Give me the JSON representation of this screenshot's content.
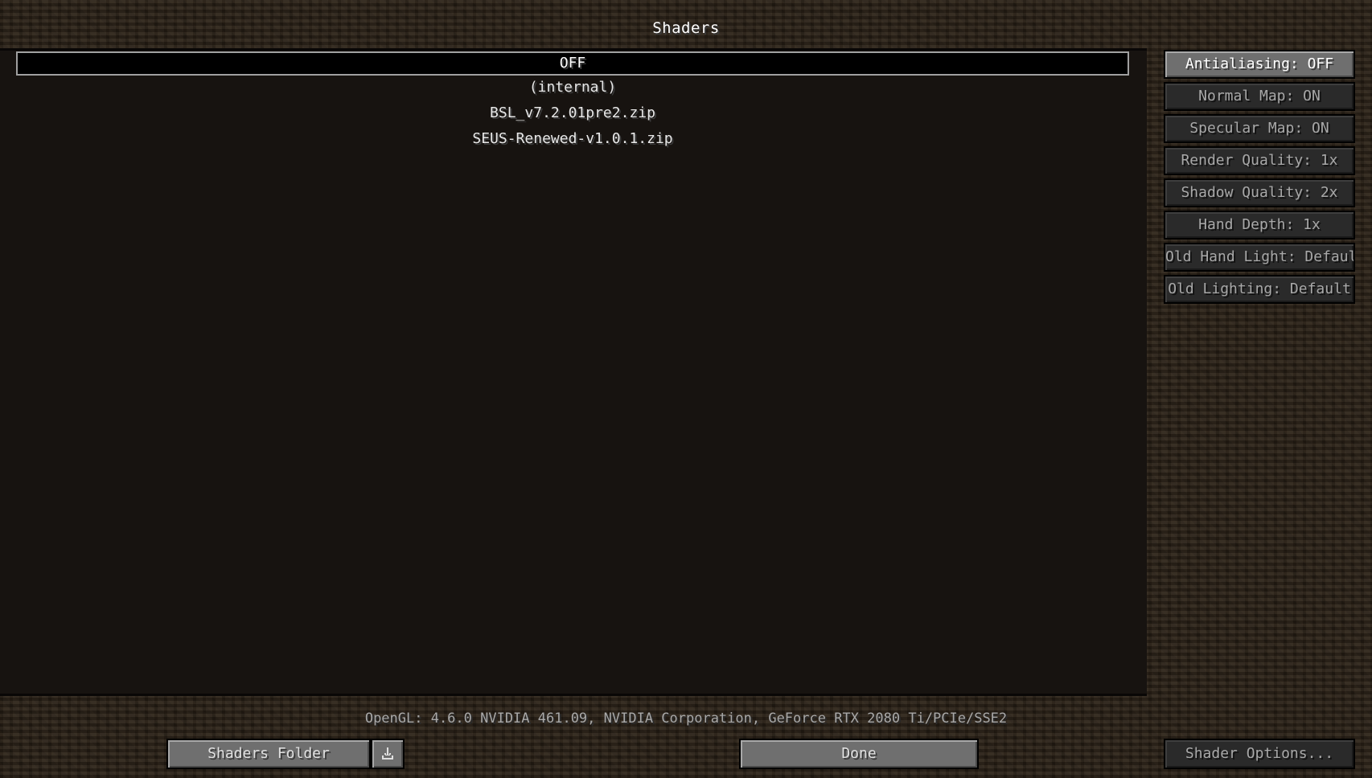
{
  "screen": {
    "title": "Shaders"
  },
  "shader_list": {
    "items": [
      {
        "label": "OFF",
        "selected": true
      },
      {
        "label": "(internal)",
        "selected": false
      },
      {
        "label": "BSL_v7.2.01pre2.zip",
        "selected": false
      },
      {
        "label": "SEUS-Renewed-v1.0.1.zip",
        "selected": false
      }
    ]
  },
  "settings": {
    "antialiasing": "Antialiasing: OFF",
    "normal_map": "Normal Map: ON",
    "specular_map": "Specular Map: ON",
    "render_quality": "Render Quality: 1x",
    "shadow_quality": "Shadow Quality: 2x",
    "hand_depth": "Hand Depth: 1x",
    "old_hand_light": "Old Hand Light: Default",
    "old_lighting": "Old Lighting: Default"
  },
  "footer": {
    "opengl_info": "OpenGL: 4.6.0 NVIDIA 461.09, NVIDIA Corporation, GeForce RTX 2080 Ti/PCIe/SSE2",
    "shaders_folder_label": "Shaders Folder",
    "download_icon": "download-icon",
    "done_label": "Done",
    "shader_options_label": "Shader Options..."
  }
}
